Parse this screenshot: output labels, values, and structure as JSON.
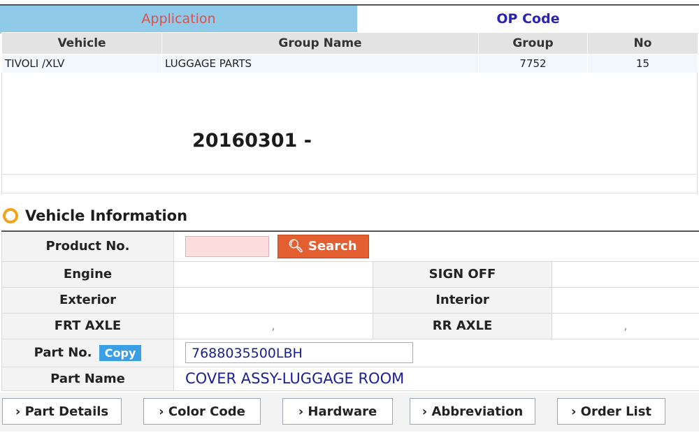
{
  "tabs": {
    "application": "Application",
    "op_code": "OP Code"
  },
  "grid": {
    "headers": [
      "Vehicle",
      "Group Name",
      "Group",
      "No"
    ],
    "row": {
      "vehicle": "TIVOLI /XLV",
      "group_name": "LUGGAGE PARTS",
      "group": "7752",
      "no": "15"
    }
  },
  "date_text": "20160301 -",
  "section": {
    "title": "Vehicle Information"
  },
  "info": {
    "product_no_label": "Product No.",
    "search_label": "Search",
    "engine_label": "Engine",
    "sign_off_label": "SIGN OFF",
    "exterior_label": "Exterior",
    "interior_label": "Interior",
    "frt_axle_label": "FRT AXLE",
    "rr_axle_label": "RR AXLE",
    "frt_axle_value": ",",
    "rr_axle_value": ",",
    "part_no_label": "Part No.",
    "copy_label": "Copy",
    "part_no_value": "7688035500LBH",
    "part_name_label": "Part Name",
    "part_name_value": "COVER ASSY-LUGGAGE ROOM"
  },
  "actions": {
    "part_details": "Part Details",
    "color_code": "Color Code",
    "hardware": "Hardware",
    "abbreviation": "Abbreviation",
    "order_list": "Order List",
    "chevron": "›"
  },
  "colors": {
    "tab_active_bg": "#8fcbe8",
    "tab_active_text": "#d9514c",
    "op_code_text": "#2a23b0",
    "search_button": "#e35e31",
    "copy_button": "#3a9fe6",
    "value_text": "#1a1f8f",
    "section_icon": "#f4a21c"
  }
}
